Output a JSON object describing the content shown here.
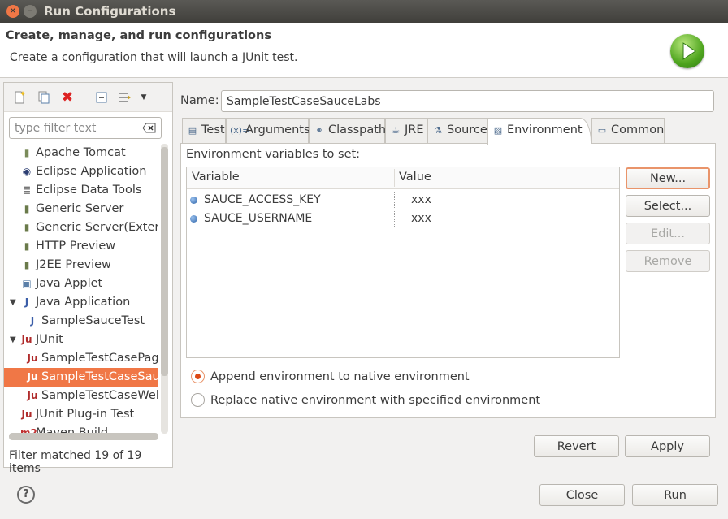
{
  "window": {
    "title": "Run Configurations",
    "close_glyph": "×",
    "minimize_glyph": "–"
  },
  "header": {
    "title": "Create, manage, and run configurations",
    "description": "Create a configuration that will launch a JUnit test."
  },
  "left": {
    "filter_placeholder": "type filter text",
    "filter_value": "",
    "status": "Filter matched 19 of 19 items",
    "tree": [
      {
        "label": "Apache Tomcat",
        "icon": "tomcat-icon",
        "glyph": "▮",
        "indent": 1
      },
      {
        "label": "Eclipse Application",
        "icon": "eclipse-icon",
        "glyph": "◉",
        "indent": 1
      },
      {
        "label": "Eclipse Data Tools",
        "icon": "database-icon",
        "glyph": "≣",
        "indent": 1
      },
      {
        "label": "Generic Server",
        "icon": "server-icon",
        "glyph": "▮",
        "indent": 1
      },
      {
        "label": "Generic Server(External Launch)",
        "icon": "server-icon",
        "glyph": "▮",
        "indent": 1
      },
      {
        "label": "HTTP Preview",
        "icon": "server-icon",
        "glyph": "▮",
        "indent": 1
      },
      {
        "label": "J2EE Preview",
        "icon": "server-icon",
        "glyph": "▮",
        "indent": 1
      },
      {
        "label": "Java Applet",
        "icon": "applet-icon",
        "glyph": "▣",
        "indent": 1
      },
      {
        "label": "Java Application",
        "icon": "java-app-icon",
        "glyph": "J",
        "indent": 1,
        "expanded": true
      },
      {
        "label": "SampleSauceTest",
        "icon": "java-app-icon",
        "glyph": "J",
        "indent": 2
      },
      {
        "label": "JUnit",
        "icon": "junit-icon",
        "glyph": "Ju",
        "indent": 1,
        "expanded": true
      },
      {
        "label": "SampleTestCasePageObjects",
        "icon": "junit-icon",
        "glyph": "Ju",
        "indent": 2
      },
      {
        "label": "SampleTestCaseSauceLabs",
        "icon": "junit-icon",
        "glyph": "Ju",
        "indent": 2,
        "selected": true
      },
      {
        "label": "SampleTestCaseWebdriver",
        "icon": "junit-icon",
        "glyph": "Ju",
        "indent": 2
      },
      {
        "label": "JUnit Plug-in Test",
        "icon": "junit-plugin-icon",
        "glyph": "Ju",
        "indent": 1
      },
      {
        "label": "Maven Build",
        "icon": "maven-icon",
        "glyph": "m2",
        "indent": 1
      }
    ]
  },
  "name": {
    "label": "Name:",
    "value": "SampleTestCaseSauceLabs"
  },
  "tabs": [
    {
      "label": "Test",
      "icon": "test-tab-icon",
      "glyph": "▤"
    },
    {
      "label": "Arguments",
      "icon": "arguments-tab-icon",
      "glyph": "(x)="
    },
    {
      "label": "Classpath",
      "icon": "classpath-tab-icon",
      "glyph": "⚭"
    },
    {
      "label": "JRE",
      "icon": "jre-tab-icon",
      "glyph": "☕"
    },
    {
      "label": "Source",
      "icon": "source-tab-icon",
      "glyph": "⚗"
    },
    {
      "label": "Environment",
      "icon": "environment-tab-icon",
      "glyph": "▧",
      "active": true
    },
    {
      "label": "Common",
      "icon": "common-tab-icon",
      "glyph": "▭"
    }
  ],
  "environment": {
    "label": "Environment variables to set:",
    "columns": [
      "Variable",
      "Value"
    ],
    "rows": [
      {
        "name": "SAUCE_ACCESS_KEY",
        "value": "xxx"
      },
      {
        "name": "SAUCE_USERNAME",
        "value": "xxx"
      }
    ],
    "buttons": {
      "new": "New...",
      "select": "Select...",
      "edit": "Edit...",
      "remove": "Remove"
    },
    "options": {
      "append": "Append environment to native environment",
      "replace": "Replace native environment with specified environment",
      "selected": "append"
    }
  },
  "footer": {
    "revert": "Revert",
    "apply": "Apply",
    "close": "Close",
    "run": "Run",
    "help": "?"
  },
  "colors": {
    "accent": "#f07746",
    "selection": "#f07746",
    "titlebar": "#4a4945"
  }
}
